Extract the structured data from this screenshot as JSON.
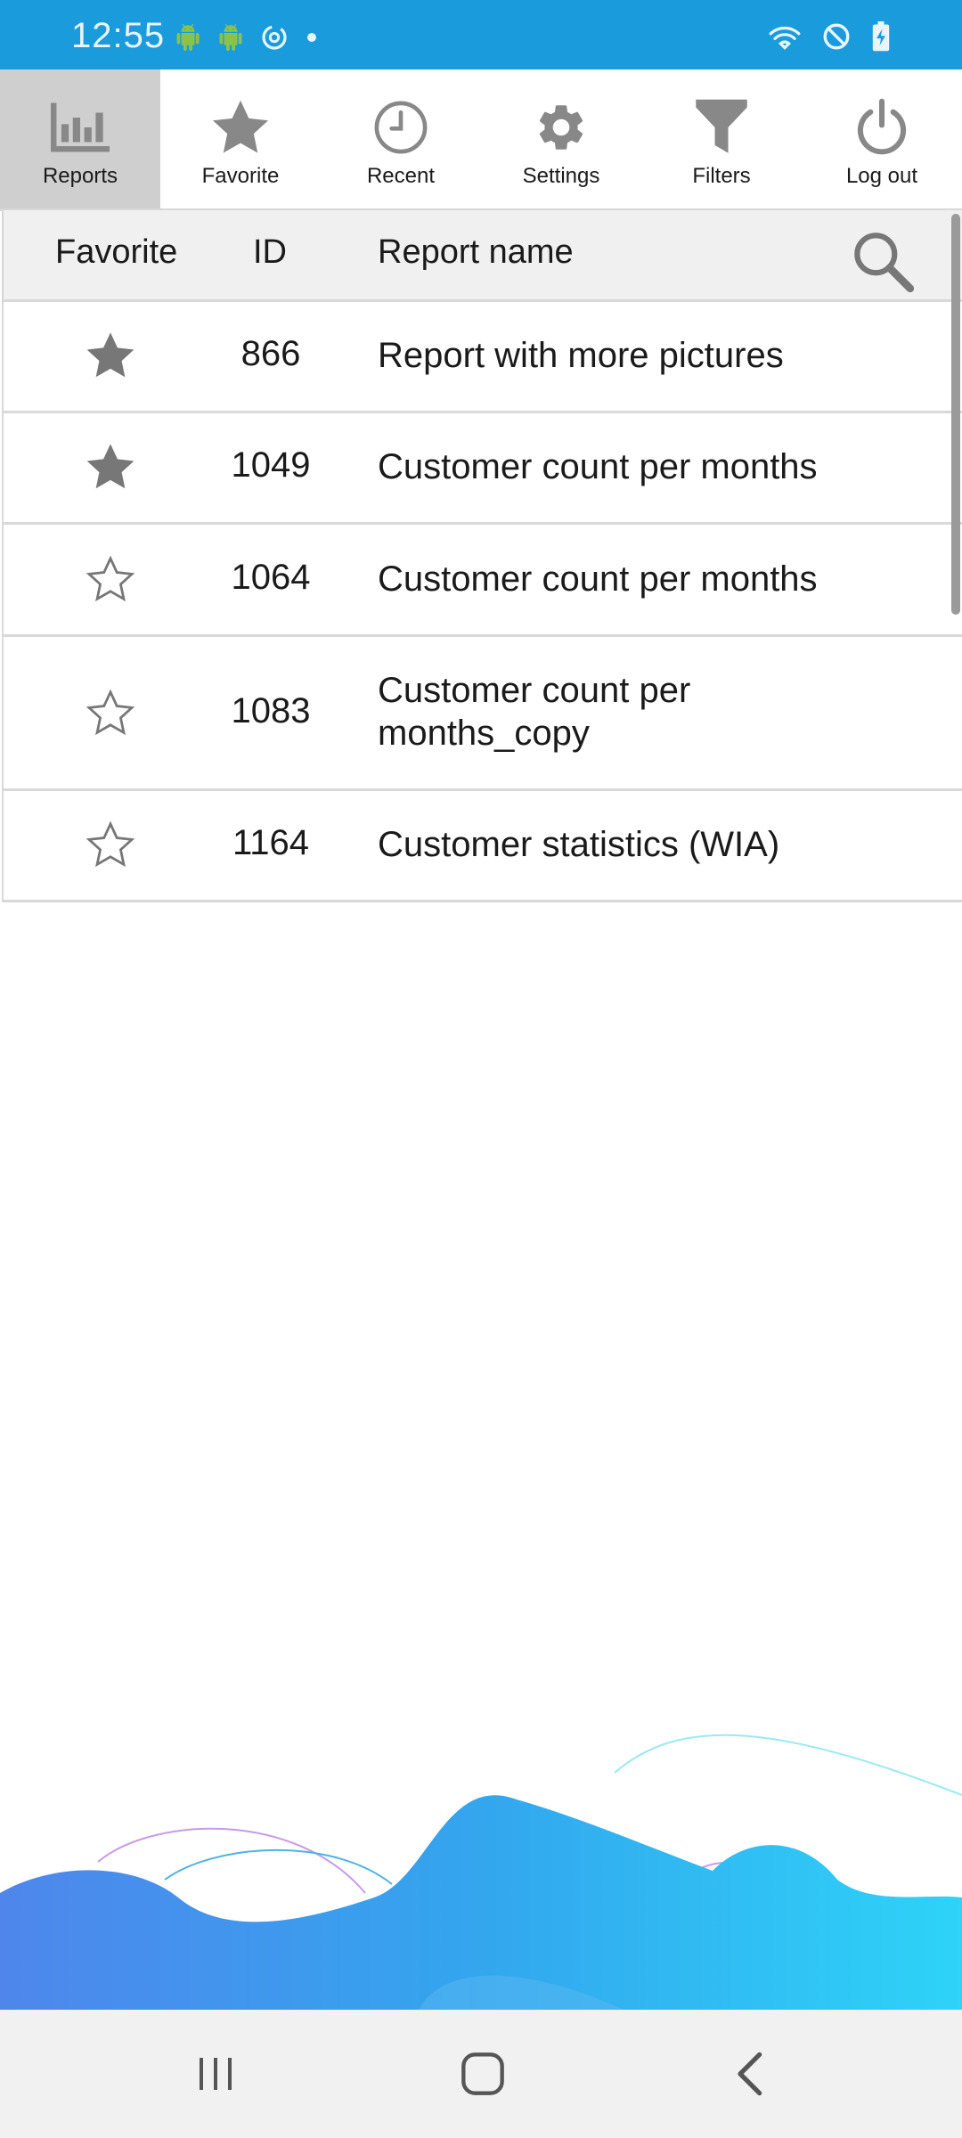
{
  "status_bar": {
    "time": "12:55",
    "icons_left": [
      "android-icon",
      "android-icon",
      "sync-icon",
      "dot-icon"
    ],
    "icons_right": [
      "wifi-icon",
      "do-not-disturb-icon",
      "battery-charging-icon"
    ],
    "color": "#1a9bdc"
  },
  "toolbar": {
    "items": [
      {
        "label": "Reports",
        "icon": "bar-chart-icon",
        "active": true
      },
      {
        "label": "Favorite",
        "icon": "star-icon",
        "active": false
      },
      {
        "label": "Recent",
        "icon": "clock-icon",
        "active": false
      },
      {
        "label": "Settings",
        "icon": "gear-icon",
        "active": false
      },
      {
        "label": "Filters",
        "icon": "filter-icon",
        "active": false
      },
      {
        "label": "Log out",
        "icon": "power-icon",
        "active": false
      }
    ]
  },
  "table": {
    "headers": {
      "favorite": "Favorite",
      "id": "ID",
      "name": "Report name"
    },
    "rows": [
      {
        "favorite": true,
        "id": "866",
        "name": "Report with more  pictures"
      },
      {
        "favorite": true,
        "id": "1049",
        "name": "Customer count per months"
      },
      {
        "favorite": false,
        "id": "1064",
        "name": "Customer count per months"
      },
      {
        "favorite": false,
        "id": "1083",
        "name": "Customer count per months_copy"
      },
      {
        "favorite": false,
        "id": "1164",
        "name": "Customer statistics (WIA)"
      }
    ]
  },
  "navbar": {
    "buttons": [
      "recent-apps-icon",
      "home-icon",
      "back-icon"
    ]
  }
}
